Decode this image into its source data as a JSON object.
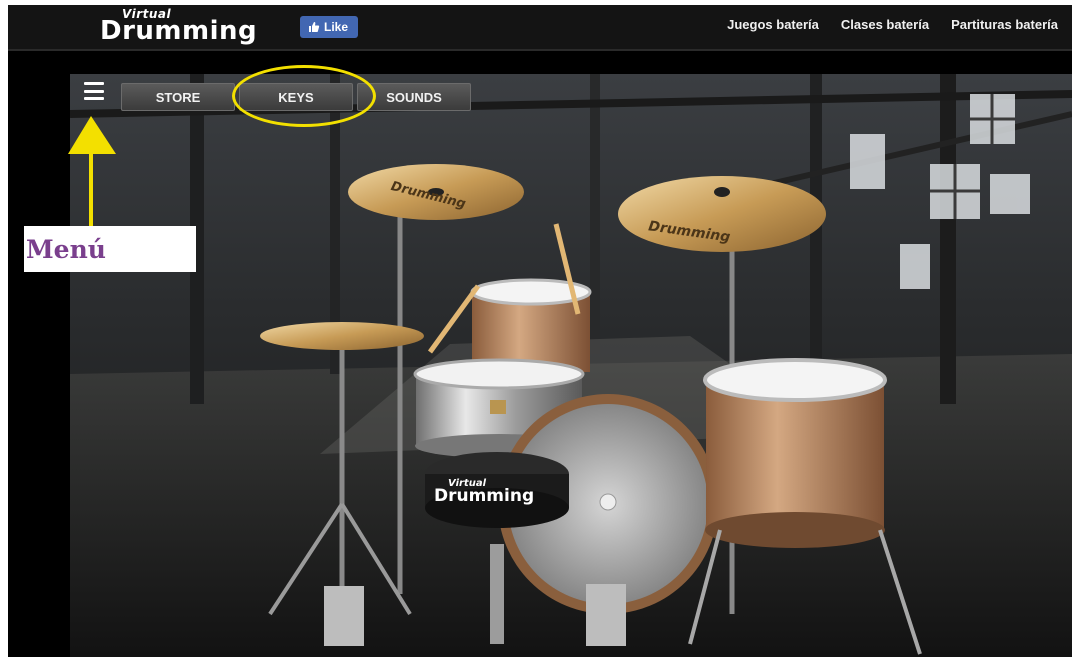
{
  "header": {
    "logo_small": "Virtual",
    "logo_big": "Drumming",
    "like_label": "Like",
    "nav": [
      "Juegos batería",
      "Clases batería",
      "Partituras batería"
    ]
  },
  "toolbar": {
    "tabs": [
      "STORE",
      "KEYS",
      "SOUNDS"
    ]
  },
  "drum_kit": {
    "cymbal_brand": "Drumming",
    "throne_logo_small": "Virtual",
    "throne_logo_big": "Drumming"
  },
  "annotation": {
    "menu_label": "Menú",
    "highlight_color": "#f3e000",
    "label_color": "#7a3f8d"
  },
  "icons": [
    "menu-icon",
    "thumbs-up-icon",
    "arrow-up-icon"
  ]
}
